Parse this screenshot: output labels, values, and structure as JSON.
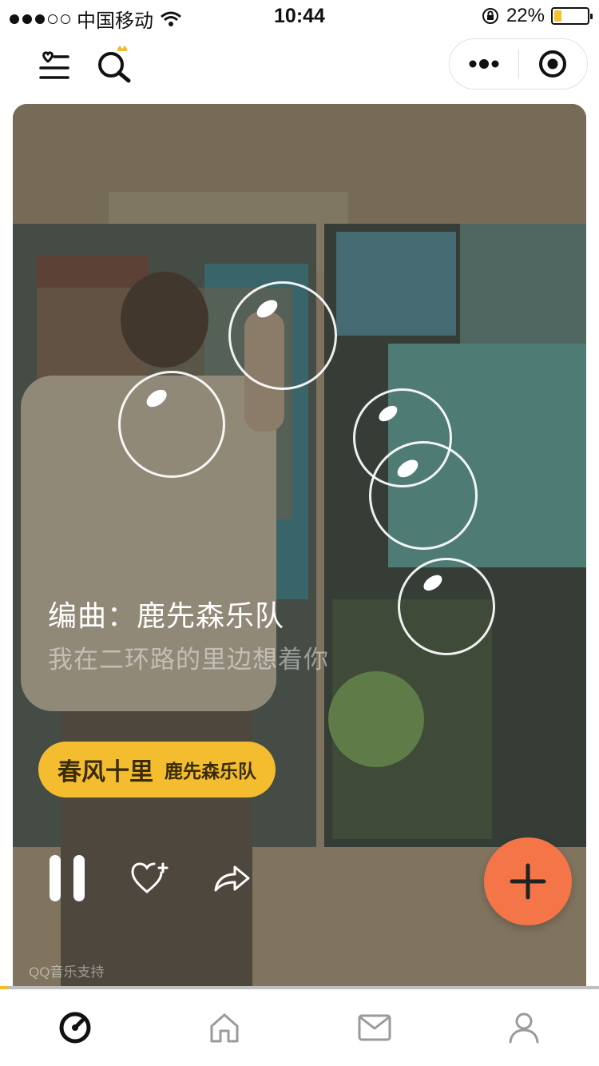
{
  "status_bar": {
    "carrier": "中国移动",
    "time": "10:44",
    "battery_pct_label": "22%",
    "battery_level": 0.22,
    "signal_bars_filled": 3,
    "signal_bars_total": 5
  },
  "nav": {
    "icons": [
      "favorites-list-icon",
      "search-icon",
      "more-icon",
      "target-icon"
    ]
  },
  "player": {
    "arranger_line": "编曲：鹿先森乐队",
    "lyric_line": "我在二环路的里边想着你",
    "song_title": "春风十里",
    "song_artist": "鹿先森乐队",
    "credit": "QQ音乐支持",
    "progress": 0.013,
    "is_playing": true
  },
  "tabs": [
    {
      "name": "discover",
      "icon": "disc-icon",
      "active": true
    },
    {
      "name": "home",
      "icon": "home-icon",
      "active": false
    },
    {
      "name": "messages",
      "icon": "mail-icon",
      "active": false
    },
    {
      "name": "profile",
      "icon": "user-icon",
      "active": false
    }
  ],
  "colors": {
    "accent_yellow": "#f3bd2f",
    "fab_orange": "#f47648",
    "active_tab": "#111111",
    "inactive_tab": "#9a9a9a"
  }
}
